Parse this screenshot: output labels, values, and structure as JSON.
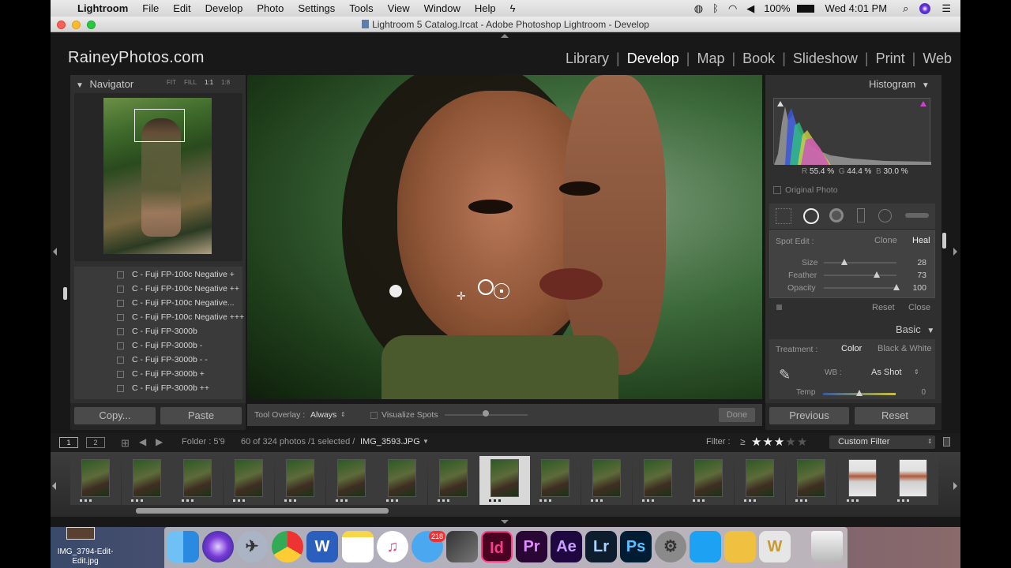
{
  "menubar": {
    "apple": "",
    "app": "Lightroom",
    "items": [
      "File",
      "Edit",
      "Develop",
      "Photo",
      "Settings",
      "Tools",
      "View",
      "Window",
      "Help"
    ],
    "battery": "100%",
    "clock": "Wed 4:01 PM"
  },
  "window": {
    "title": "Lightroom 5 Catalog.lrcat - Adobe Photoshop Lightroom - Develop"
  },
  "brand": "RaineyPhotos.com",
  "modules": [
    "Library",
    "Develop",
    "Map",
    "Book",
    "Slideshow",
    "Print",
    "Web"
  ],
  "navigator": {
    "title": "Navigator",
    "zoom": [
      "FIT",
      "FILL",
      "1:1",
      "1:8"
    ]
  },
  "presets": [
    "C - Fuji FP-100c Negative +",
    "C - Fuji FP-100c Negative ++",
    "C - Fuji FP-100c Negative...",
    "C - Fuji FP-100c Negative +++",
    "C - Fuji FP-3000b",
    "C - Fuji FP-3000b -",
    "C - Fuji FP-3000b - -",
    "C - Fuji FP-3000b +",
    "C - Fuji FP-3000b ++"
  ],
  "left_buttons": {
    "copy": "Copy...",
    "paste": "Paste"
  },
  "toolbar": {
    "tool_overlay_label": "Tool Overlay :",
    "tool_overlay_value": "Always",
    "visualize_spots": "Visualize Spots",
    "done": "Done"
  },
  "histogram": {
    "title": "Histogram",
    "r_label": "R",
    "r": "55.4",
    "g_label": "G",
    "g": "44.4",
    "b_label": "B",
    "b": "30.0",
    "pct": "%",
    "original_photo": "Original Photo"
  },
  "spot": {
    "label": "Spot Edit :",
    "clone": "Clone",
    "heal": "Heal",
    "size_label": "Size",
    "size": "28",
    "feather_label": "Feather",
    "feather": "73",
    "opacity_label": "Opacity",
    "opacity": "100",
    "size_pct": 0.28,
    "feather_pct": 0.73,
    "opacity_pct": 1.0,
    "reset": "Reset",
    "close": "Close"
  },
  "basic": {
    "title": "Basic",
    "treatment_label": "Treatment :",
    "color": "Color",
    "bw": "Black & White",
    "wb_label": "WB :",
    "wb_value": "As Shot",
    "temp_label": "Temp",
    "temp_value": "0"
  },
  "right_buttons": {
    "previous": "Previous",
    "reset": "Reset"
  },
  "filmbar": {
    "view1": "1",
    "view2": "2",
    "folder": "Folder : 5'9",
    "info": "60 of 324 photos /1 selected /",
    "file": "IMG_3593.JPG",
    "filter_label": "Filter :",
    "filter_op": "≥",
    "rating": 3,
    "rating_max": 5,
    "custom_filter": "Custom Filter"
  },
  "filmstrip": {
    "count": 17,
    "selected_index": 8
  },
  "desktop_file": {
    "line1": "IMG_3794-Edit-",
    "line2": "Edit.jpg"
  },
  "dock": {
    "badge": "218",
    "apps": [
      {
        "name": "finder",
        "label": ""
      },
      {
        "name": "siri",
        "label": ""
      },
      {
        "name": "launchpad",
        "label": ""
      },
      {
        "name": "chrome",
        "label": ""
      },
      {
        "name": "word",
        "label": "W"
      },
      {
        "name": "notes",
        "label": ""
      },
      {
        "name": "itunes",
        "label": "♫"
      },
      {
        "name": "messages",
        "label": ""
      },
      {
        "name": "finalcut",
        "label": ""
      },
      {
        "name": "indesign",
        "label": "Id"
      },
      {
        "name": "premiere",
        "label": "Pr"
      },
      {
        "name": "aftereffects",
        "label": "Ae"
      },
      {
        "name": "lightroom",
        "label": "Lr"
      },
      {
        "name": "photoshop",
        "label": "Ps"
      },
      {
        "name": "system-preferences",
        "label": "⚙"
      },
      {
        "name": "twitter",
        "label": ""
      },
      {
        "name": "transmit",
        "label": ""
      },
      {
        "name": "app-w",
        "label": "W"
      },
      {
        "name": "trash",
        "label": ""
      }
    ]
  },
  "colors": {
    "accent_bg": "#181818",
    "panel": "#2f2f2f",
    "indesign": "#49021f",
    "premiere": "#2a0634",
    "aftereffects": "#1f0740",
    "lightroom": "#0d1d2e",
    "photoshop": "#001d34"
  }
}
